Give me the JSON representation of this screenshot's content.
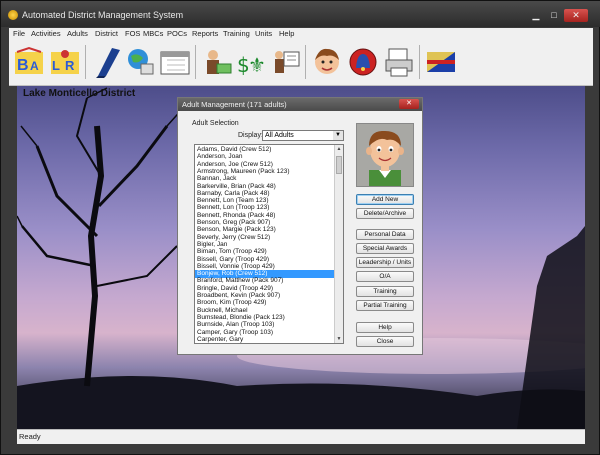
{
  "window": {
    "title": "Automated District Management System"
  },
  "menu": [
    "File",
    "Activities",
    "Adults",
    "District",
    "FOS",
    "MBCs",
    "POCs",
    "Reports",
    "Training",
    "Units",
    "Help"
  ],
  "toolbar_icons": [
    "bsa-icon",
    "ler-icon",
    "book-icon",
    "globe-person-icon",
    "calendar-icon",
    "money-person-icon",
    "money-fleur-icon",
    "presentation-icon",
    "boy-face-icon",
    "bell-icon",
    "printer-icon",
    "flag-icon"
  ],
  "desktop": {
    "district_label": "Lake Monticello District"
  },
  "status": "Ready",
  "dialog": {
    "title": "Adult Management   (171 adults)",
    "section_label": "Adult Selection",
    "display_label": "Display:",
    "display_value": "All Adults",
    "adults": [
      "Adams,   David   (Crew 512)",
      "Anderson,   Joan",
      "Anderson,   Joe   (Crew 512)",
      "Armstrong,   Maureen   (Pack 123)",
      "Bannan,   Jack",
      "Barkerville,   Brian   (Pack 48)",
      "Barnaby,   Carla   (Pack 48)",
      "Bennett,   Lon   (Team 123)",
      "Bennett,   Lon   (Troop 123)",
      "Bennett,   Rhonda   (Pack 48)",
      "Benson,   Greg   (Pack 907)",
      "Benson,   Margie   (Pack 123)",
      "Beverly,   Jerry   (Crew 512)",
      "Bigler,   Jan",
      "Biman,   Tom   (Troop 429)",
      "Bissell,   Gary   (Troop 429)",
      "Bissell,   Vonnie   (Troop 429)",
      "Bonjew,   Rob   (Crew 512)",
      "Branford,   Matthew   (Pack 907)",
      "Bringle,   David   (Troop 429)",
      "Broadbent,   Kevin   (Pack 907)",
      "Broom,   Kim   (Troop 429)",
      "Bucknell,   Michael",
      "Bumstead,   Blondie   (Pack 123)",
      "Burnside,   Alan   (Troop 103)",
      "Camper,   Gary   (Troop 103)",
      "Carpenter,   Gary"
    ],
    "selected_index": 17,
    "buttons": {
      "add_new": "Add New",
      "delete_archive": "Delete/Archive",
      "personal_data": "Personal Data",
      "special_awards": "Special Awards",
      "leadership_units": "Leadership / Units",
      "oa": "O/A",
      "training": "Training",
      "partial_training": "Partial Training",
      "help": "Help",
      "close": "Close"
    }
  }
}
